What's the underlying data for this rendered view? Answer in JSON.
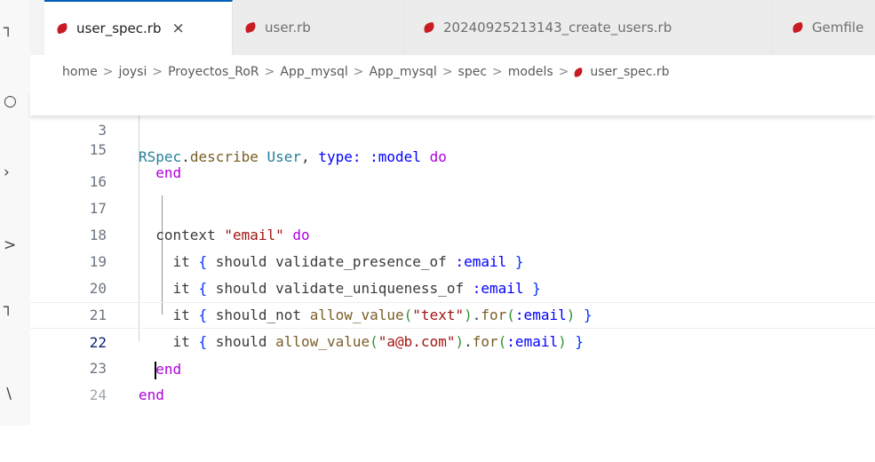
{
  "tabs": [
    {
      "label": "user_spec.rb",
      "active": true,
      "close": "×"
    },
    {
      "label": "user.rb",
      "active": false
    },
    {
      "label": "20240925213143_create_users.rb",
      "active": false
    },
    {
      "label": "Gemfile",
      "active": false
    }
  ],
  "breadcrumb": [
    "home",
    "joysi",
    "Proyectos_RoR",
    "App_mysql",
    "App_mysql",
    "spec",
    "models",
    "user_spec.rb"
  ],
  "breadcrumb_separator": ">",
  "editor": {
    "sticky": {
      "number": "3",
      "text": "RSpec.describe User, type: :model do"
    },
    "current_line": "22",
    "lines": [
      {
        "number": "15",
        "text": "  end"
      },
      {
        "number": "16",
        "text": ""
      },
      {
        "number": "17",
        "text": "  context \"email\" do"
      },
      {
        "number": "18",
        "text": "    it { should validate_presence_of :email }"
      },
      {
        "number": "19",
        "text": "    it { should validate_uniqueness_of :email }"
      },
      {
        "number": "20",
        "text": "    it { should_not allow_value(\"text\").for(:email) }"
      },
      {
        "number": "21",
        "text": "    it { should allow_value(\"a@b.com\").for(:email) }"
      },
      {
        "number": "22",
        "text": "  end"
      },
      {
        "number": "23",
        "text": "end"
      },
      {
        "number": "24",
        "text": ""
      }
    ]
  },
  "colors": {
    "keyword": "#af00db",
    "constant": "#267f99",
    "symbol": "#0000ff",
    "string": "#a31515",
    "method": "#795e26",
    "accent": "#005fb8",
    "ruby_icon": "#c81c24"
  },
  "icons": [
    "explorer-icon",
    "search-icon",
    "source-control-icon",
    "run-debug-icon",
    "extensions-icon",
    "testing-icon"
  ]
}
